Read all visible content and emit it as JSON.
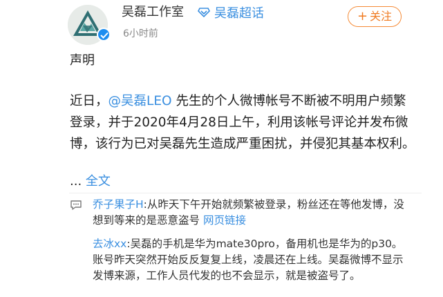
{
  "post": {
    "author_name": "吴磊工作室",
    "supertopic_label": "吴磊超话",
    "time": "6小时前",
    "follow_label": "关注",
    "follow_plus": "+",
    "heading": "声明",
    "body_prefix": "近日，",
    "mention": "@吴磊LEO",
    "body_rest": " 先生的个人微博帐号不断被不明用户频繁登录，并于2020年4月28日上午，利用该帐号评论并发布微博，该行为已对吴磊先生造成严重困扰，并侵犯其基本权利。",
    "ellipsis": "... ",
    "more_label": "全文"
  },
  "comments": [
    {
      "user": "乔子果子H",
      "text": ":从昨天下午开始就频繁被登录，粉丝还在等他发博，没想到等来的是恶意盗号 ",
      "link": "网页链接"
    },
    {
      "user": "去冰xx",
      "text": ":吴磊的手机是华为mate30pro，备用机也是华为的p30。账号昨天突然开始反反复复上线，凌晨还在上线。吴磊微博不显示发博来源，工作人员代发的也不会显示，就是被盗号了。"
    }
  ],
  "icons": {
    "avatar": "studio-logo-avatar",
    "verified": "verified-badge-icon",
    "supertopic": "diamond-icon",
    "comment": "comment-icon"
  },
  "colors": {
    "link": "#3a8fe0",
    "follow": "#f07a20",
    "verified": "#1d8ef0"
  }
}
